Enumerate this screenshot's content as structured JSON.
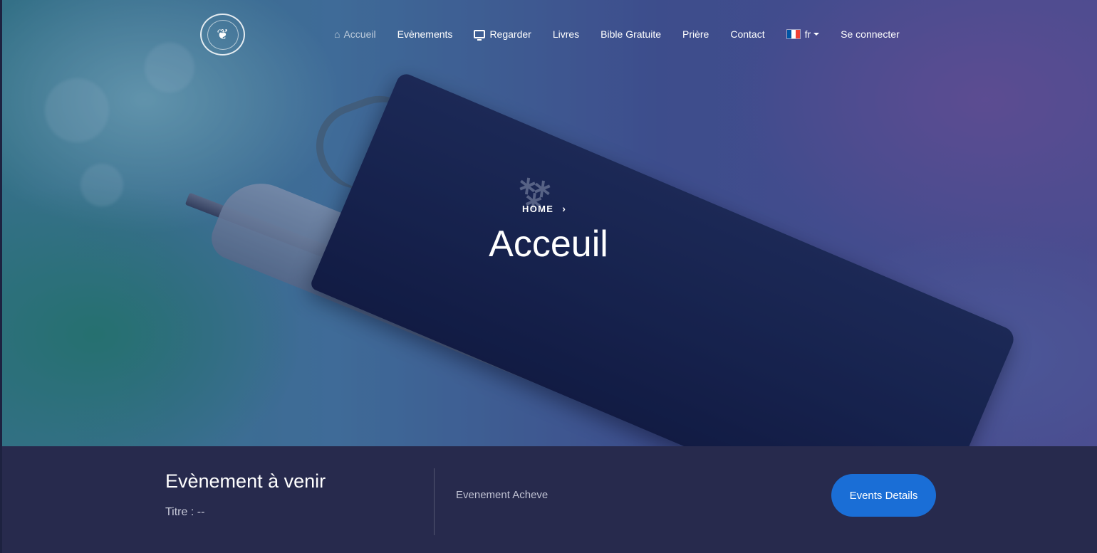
{
  "nav": {
    "items": [
      {
        "label": "Accueil",
        "icon": "home-icon",
        "active": true
      },
      {
        "label": "Evènements"
      },
      {
        "label": "Regarder",
        "icon": "tv-icon"
      },
      {
        "label": "Livres"
      },
      {
        "label": "Bible Gratuite"
      },
      {
        "label": "Prière"
      },
      {
        "label": "Contact"
      }
    ],
    "language": {
      "label": "fr",
      "icon": "france-flag-icon"
    },
    "login": "Se connecter"
  },
  "hero": {
    "breadcrumb": "HOME",
    "title": "Acceuil"
  },
  "event": {
    "heading": "Evènement à venir",
    "title_line": "Titre : --",
    "status": "Evenement Acheve",
    "button": "Events Details"
  },
  "colors": {
    "event_bar": "#272a4d",
    "button": "#1a6ed6",
    "flag_blue": "#0055a4",
    "flag_white": "#ffffff",
    "flag_red": "#ef4135"
  }
}
